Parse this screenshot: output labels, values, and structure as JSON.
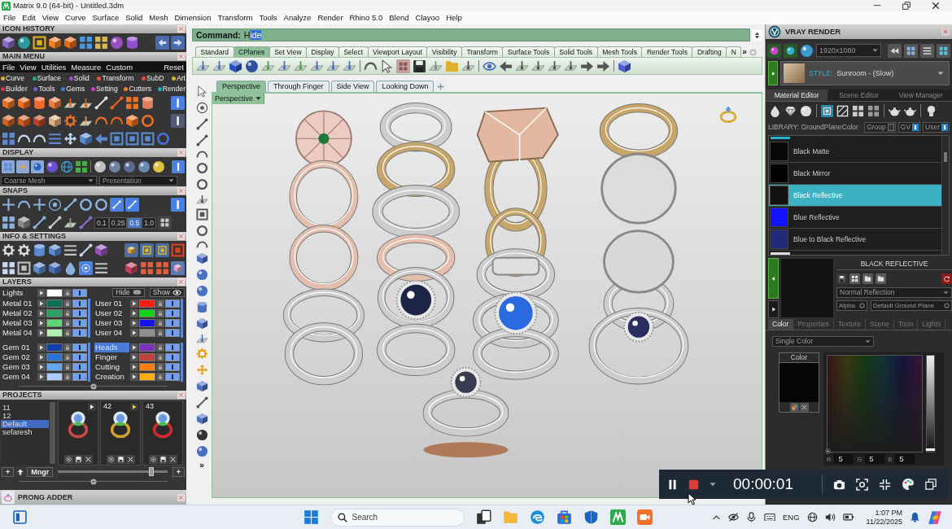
{
  "window": {
    "title": "Matrix 9.0 (64-bit) - Untitled.3dm"
  },
  "menu_bar": [
    "File",
    "Edit",
    "View",
    "Curve",
    "Surface",
    "Solid",
    "Mesh",
    "Dimension",
    "Transform",
    "Tools",
    "Analyze",
    "Render",
    "Rhino 5.0",
    "Blend",
    "Clayoo",
    "Help"
  ],
  "left_panel": {
    "icon_history": {
      "title": "ICON HISTORY"
    },
    "main_menu": {
      "title": "MAIN MENU",
      "menu": [
        "File",
        "View",
        "Utilities",
        "Measure",
        "Custom"
      ],
      "reset": "Reset",
      "categories": [
        {
          "label": "Curve",
          "color": "#d8b42c"
        },
        {
          "label": "Surface",
          "color": "#2fa37a"
        },
        {
          "label": "Solid",
          "color": "#9b4fd0"
        },
        {
          "label": "Transform",
          "color": "#e2502e"
        },
        {
          "label": "SubD",
          "color": "#e24a36"
        },
        {
          "label": "Art",
          "color": "#d6b22a"
        },
        {
          "label": "Builder",
          "color": "#e0303e"
        },
        {
          "label": "Tools",
          "color": "#7b5fd2"
        },
        {
          "label": "Gems",
          "color": "#3a7fd2"
        },
        {
          "label": "Setting",
          "color": "#d03fc4"
        },
        {
          "label": "Cutters",
          "color": "#e7861f"
        },
        {
          "label": "Render",
          "color": "#1fb0b0"
        }
      ]
    },
    "display": {
      "title": "DISPLAY",
      "mesh": "Coarse Mesh",
      "mode": "Presentation"
    },
    "snaps": {
      "title": "SNAPS",
      "steps": [
        {
          "label": "0.1",
          "selected": false
        },
        {
          "label": "0.25",
          "selected": false
        },
        {
          "label": "0.5",
          "selected": true
        },
        {
          "label": "1.0",
          "selected": false
        }
      ]
    },
    "info_settings": {
      "title": "INFO & SETTINGS"
    },
    "layers": {
      "title": "LAYERS",
      "lights": {
        "name": "Lights",
        "color": "#ffffff",
        "visible": true,
        "selected": false
      },
      "hide": "Hide",
      "show": "Show",
      "groups": [
        {
          "layers": [
            {
              "name": "Metal 01",
              "color": "#0b6e52",
              "visible": true,
              "selected": false
            },
            {
              "name": "Metal 02",
              "color": "#2c9f62",
              "visible": true,
              "selected": false
            },
            {
              "name": "Metal 03",
              "color": "#5fd673",
              "visible": true,
              "selected": false
            },
            {
              "name": "Metal 04",
              "color": "#b2f0b4",
              "visible": true,
              "selected": false
            }
          ]
        },
        {
          "layers": [
            {
              "name": "User 01",
              "color": "#ff1a12",
              "visible": true,
              "selected": false
            },
            {
              "name": "User 02",
              "color": "#14d21a",
              "visible": true,
              "selected": false
            },
            {
              "name": "User 03",
              "color": "#1414ee",
              "visible": true,
              "selected": false
            },
            {
              "name": "User 04",
              "color": "#8e8e8e",
              "visible": true,
              "selected": false
            }
          ]
        },
        {
          "layers": [
            {
              "name": "Gem 01",
              "color": "#0f3fa6",
              "visible": true,
              "selected": false
            },
            {
              "name": "Gem 02",
              "color": "#2f72d6",
              "visible": true,
              "selected": false
            },
            {
              "name": "Gem 03",
              "color": "#64a6f2",
              "visible": true,
              "selected": false
            },
            {
              "name": "Gem 04",
              "color": "#a9ceff",
              "visible": true,
              "selected": false
            }
          ]
        },
        {
          "layers": [
            {
              "name": "Heads",
              "color": "#7f2fbf",
              "visible": true,
              "selected": true
            },
            {
              "name": "Finger",
              "color": "#c0433d",
              "visible": true,
              "selected": false
            },
            {
              "name": "Cutting",
              "color": "#ff7f0a",
              "visible": true,
              "selected": false
            },
            {
              "name": "Creation",
              "color": "#ffae0a",
              "visible": true,
              "selected": false
            }
          ]
        }
      ]
    },
    "projects": {
      "title": "PROJECTS",
      "list": [
        {
          "label": "11",
          "selected": false
        },
        {
          "label": "12",
          "selected": false
        },
        {
          "label": "Default",
          "selected": true
        },
        {
          "label": "sefaresh",
          "selected": false
        }
      ],
      "thumbnails": [
        {
          "color": "#c84848",
          "marked": false
        },
        {
          "number": "42",
          "color": "#d4a22c",
          "marked": true
        },
        {
          "number": "43",
          "color": "#d42a2a"
        }
      ],
      "add_button": "+",
      "manager_button": "Mngr",
      "zoom_button": "+",
      "size_slider": {
        "level": 0.85
      }
    },
    "prong_adder": {
      "title": "PRONG ADDER"
    }
  },
  "viewport_area": {
    "command": {
      "label": "Command:",
      "typed": "H",
      "completion": "ide"
    },
    "toolbar_tabs": [
      {
        "label": "Standard",
        "selected": false
      },
      {
        "label": "CPlanes",
        "selected": true
      },
      {
        "label": "Set View",
        "selected": false
      },
      {
        "label": "Display",
        "selected": false
      },
      {
        "label": "Select",
        "selected": false
      },
      {
        "label": "Viewport Layout",
        "selected": false
      },
      {
        "label": "Visibility",
        "selected": false
      },
      {
        "label": "Transform",
        "selected": false
      },
      {
        "label": "Surface Tools",
        "selected": false
      },
      {
        "label": "Solid Tools",
        "selected": false
      },
      {
        "label": "Mesh Tools",
        "selected": false
      },
      {
        "label": "Render Tools",
        "selected": false
      },
      {
        "label": "Drafting",
        "selected": false
      },
      {
        "label": "N",
        "selected": false
      }
    ],
    "more_tabs": "»",
    "viewport_tabs": [
      {
        "label": "Perspective",
        "selected": true
      },
      {
        "label": "Through Finger",
        "selected": false
      },
      {
        "label": "Side View",
        "selected": false
      },
      {
        "label": "Looking Down",
        "selected": false
      }
    ],
    "viewport_label": "Perspective",
    "tool_overflow": "»"
  },
  "vray_panel": {
    "title": "VRAY RENDER",
    "resolution": "1920x1080",
    "style_label": "STYLE:",
    "style": "Sunroom - (Slow)",
    "tabs": [
      {
        "label": "Material Editor",
        "selected": true
      },
      {
        "label": "Scene Editor",
        "selected": false
      },
      {
        "label": "View Manager",
        "selected": false
      }
    ],
    "library": "LIBRARY: GroundPlaneColor",
    "filters": [
      {
        "label": "Group",
        "on": false
      },
      {
        "label": "GV",
        "on": true
      },
      {
        "label": "User",
        "on": true
      }
    ],
    "materials": [
      {
        "name": "Black Matte",
        "color": "#080808",
        "selected": false
      },
      {
        "name": "Black Mirror",
        "color": "#010101",
        "selected": false
      },
      {
        "name": "Black Reflective",
        "color": "#111111",
        "selected": true
      },
      {
        "name": "Blue Reflective",
        "color": "#1212ff",
        "selected": false
      },
      {
        "name": "Blue to Black Reflective",
        "color": "#1f2a78",
        "selected": false
      }
    ],
    "material_title": "BLACK REFLECTIVE",
    "reflection": "Normal Reflection",
    "alpha": "Alpha",
    "ground_plane": "Default Ground Plane",
    "property_tabs": [
      {
        "label": "Color",
        "selected": true
      },
      {
        "label": "Properties",
        "selected": false
      },
      {
        "label": "Texture",
        "selected": false
      },
      {
        "label": "Scene",
        "selected": false
      },
      {
        "label": "Toon",
        "selected": false
      },
      {
        "label": "Lights",
        "selected": false
      }
    ],
    "color_mode": "Single Color",
    "color_title": "Color",
    "brightness": {
      "level": 0.02
    },
    "rgb": [
      {
        "label": "R",
        "value": "5"
      },
      {
        "label": "G",
        "value": "5"
      },
      {
        "label": "B",
        "value": "5"
      }
    ]
  },
  "recorder": {
    "time": "00:00:01"
  },
  "taskbar": {
    "search_placeholder": "Search",
    "language": "ENG",
    "time": "1:07 PM",
    "date": "11/22/2025"
  }
}
